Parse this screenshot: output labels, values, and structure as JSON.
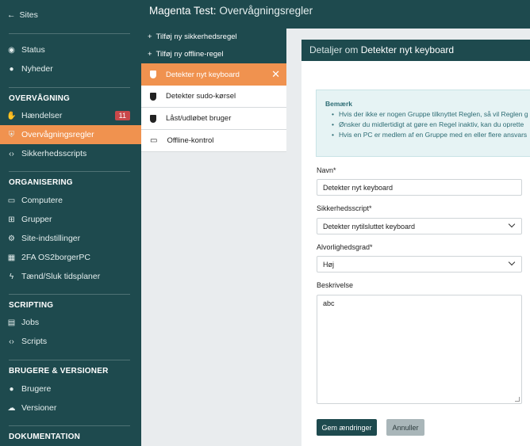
{
  "sidebar": {
    "back_label": "Sites",
    "status": "Status",
    "news": "Nyheder",
    "sections": {
      "monitoring": "OVERVÅGNING",
      "organising": "ORGANISERING",
      "scripting": "SCRIPTING",
      "users": "BRUGERE & VERSIONER",
      "docs": "DOKUMENTATION"
    },
    "events": "Hændelser",
    "events_badge": "11",
    "rules": "Overvågningsregler",
    "security_scripts": "Sikkerhedsscripts",
    "computers": "Computere",
    "groups": "Grupper",
    "site_settings": "Site-indstillinger",
    "twofa": "2FA OS2borgerPC",
    "schedules": "Tænd/Sluk tidsplaner",
    "jobs": "Jobs",
    "scripts": "Scripts",
    "users_item": "Brugere",
    "versions": "Versioner"
  },
  "header": {
    "site": "Magenta Test:",
    "page": "Overvågningsregler"
  },
  "rule_list": {
    "add_security": "Tilføj ny sikkerhedsregel",
    "add_offline": "Tilføj ny offline-regel",
    "items": [
      {
        "label": "Detekter nyt keyboard"
      },
      {
        "label": "Detekter sudo-kørsel"
      },
      {
        "label": "Låst/udløbet bruger"
      },
      {
        "label": "Offline-kontrol"
      }
    ]
  },
  "details": {
    "title_prefix": "Detaljer om",
    "title_name": "Detekter nyt keyboard",
    "note_title": "Bemærk",
    "note_items": [
      "Hvis der ikke er nogen Gruppe tilknyttet Reglen, så vil Reglen g",
      "Ønsker du midlertidigt at gøre en Regel inaktiv, kan du oprette",
      "Hvis en PC er medlem af en Gruppe med en eller flere ansvars"
    ],
    "name_label": "Navn*",
    "name_value": "Detekter nyt keyboard",
    "script_label": "Sikkerhedsscript*",
    "script_value": "Detekter nytilsluttet keyboard",
    "severity_label": "Alvorlighedsgrad*",
    "severity_value": "Høj",
    "description_label": "Beskrivelse",
    "description_value": "abc",
    "save_label": "Gem ændringer",
    "cancel_label": "Annuller"
  }
}
